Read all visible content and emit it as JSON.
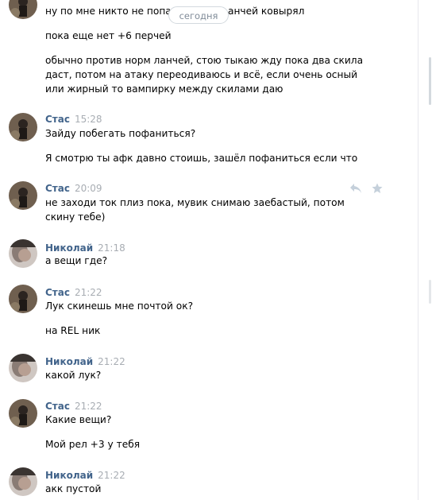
{
  "date_separator": "сегодня",
  "first_block": {
    "lines": [
      "ну по мне никто не попад",
      "анчей ковырял",
      "пока еще нет +6 перчей",
      "обычно против норм ланчей, стою тыкаю жду пока два скила",
      "даст, потом на атаку переодиваюсь и всё, если очень осный",
      "или жирный то вампирку между скилами даю"
    ]
  },
  "messages": [
    {
      "author": "Стас",
      "time": "15:28",
      "lines": [
        "Зайду побегать пофаниться?",
        "Я смотрю ты афк давно стоишь, зашёл пофаниться если что"
      ]
    },
    {
      "author": "Стас",
      "time": "20:09",
      "lines": [
        "не заходи ток плиз пока, мувик снимаю заебастый, потом",
        "скину тебе)"
      ]
    },
    {
      "author": "Николай",
      "time": "21:18",
      "lines": [
        "а вещи где?"
      ]
    },
    {
      "author": "Стас",
      "time": "21:22",
      "lines": [
        "Лук скинешь мне почтой ок?",
        "на REL ник"
      ]
    },
    {
      "author": "Николай",
      "time": "21:22",
      "lines": [
        "какой лук?"
      ]
    },
    {
      "author": "Стас",
      "time": "21:22",
      "lines": [
        "Какие вещи?",
        "Мой рел +3 у тебя"
      ]
    },
    {
      "author": "Николай",
      "time": "21:22",
      "lines": [
        "акк пустой"
      ]
    }
  ],
  "icons": {
    "reply": "reply-icon",
    "favorite": "star-icon"
  },
  "colors": {
    "author": "#42648b",
    "time": "#a8adb3",
    "icon": "#c5d0db"
  }
}
